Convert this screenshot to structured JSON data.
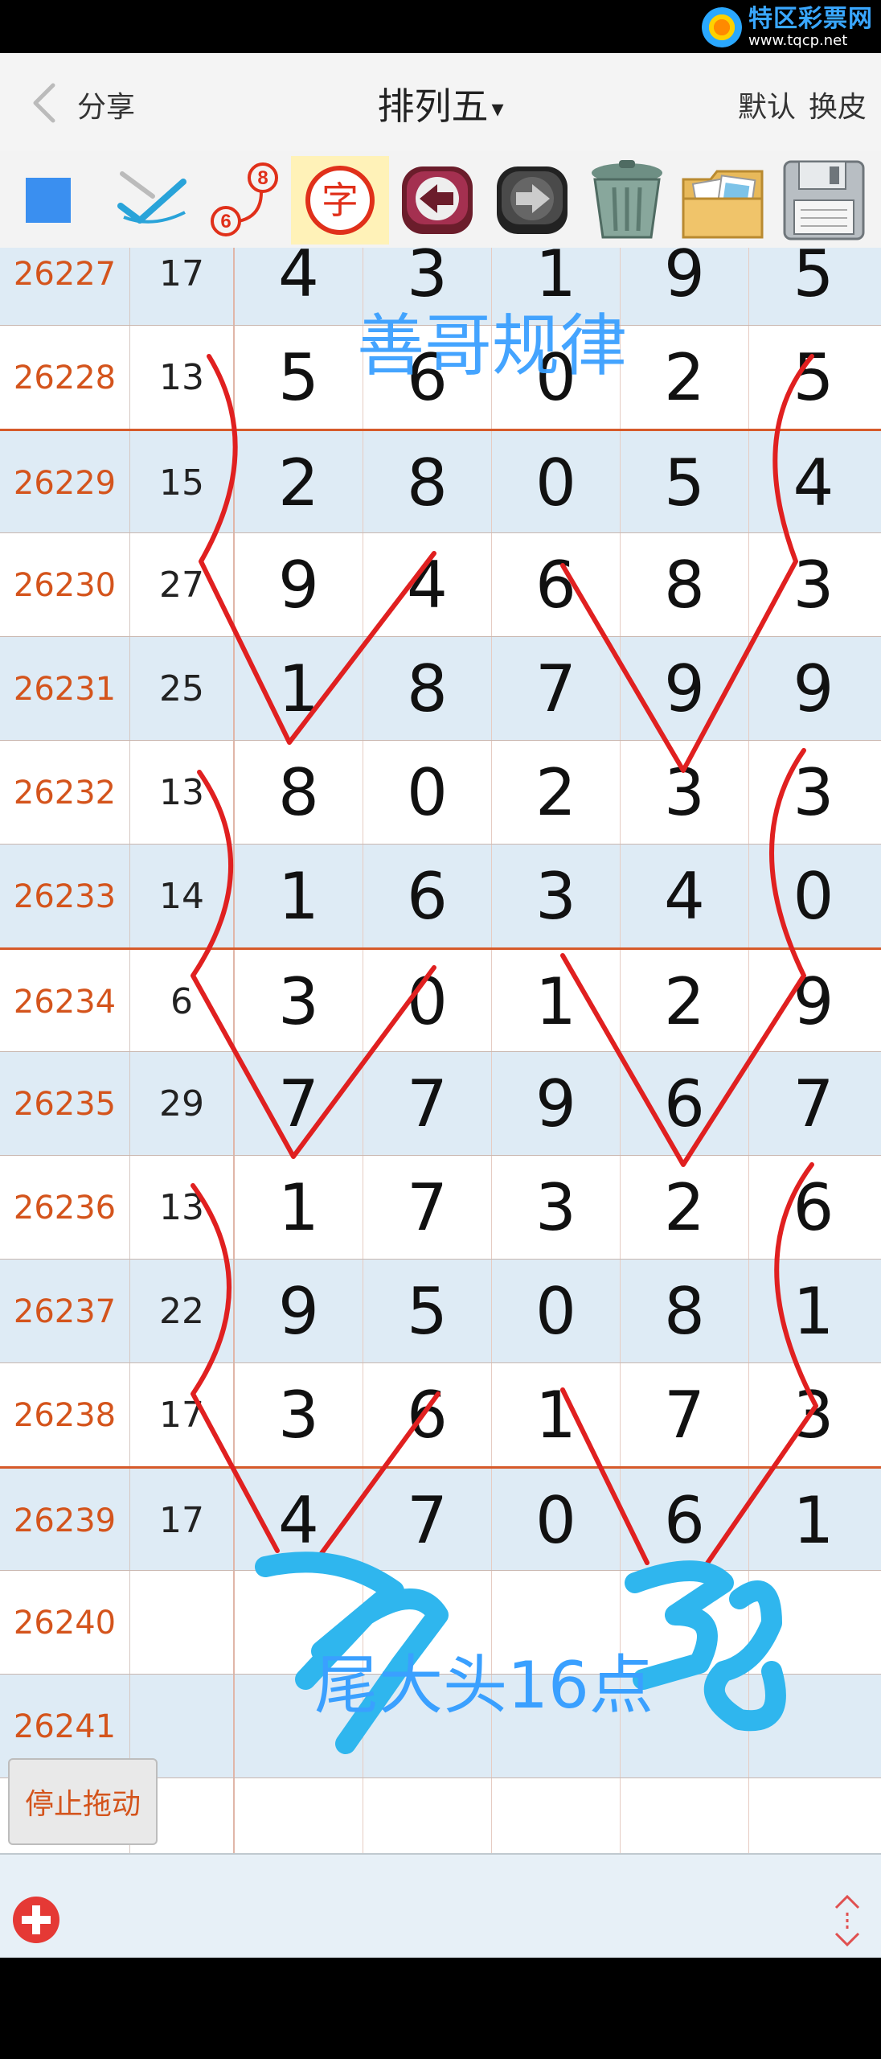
{
  "watermark": {
    "title": "特区彩票网",
    "url": "www.tqcp.net"
  },
  "header": {
    "share_label": "分享",
    "title": "排列五",
    "title_caret": "▾",
    "action_default": "默认",
    "action_skin": "换皮"
  },
  "toolbar": {
    "tools": [
      "square-tool",
      "pen-check-tool",
      "line-6-8-tool",
      "character-tool",
      "undo-tool",
      "redo-tool",
      "trash-tool",
      "gallery-tool",
      "save-tool"
    ],
    "char_glyph": "字",
    "num_six": "6",
    "num_eight": "8"
  },
  "table": {
    "rows": [
      {
        "issue": "26227",
        "sum": "17",
        "digits": [
          "4",
          "3",
          "1",
          "9",
          "5"
        ]
      },
      {
        "issue": "26228",
        "sum": "13",
        "digits": [
          "5",
          "6",
          "0",
          "2",
          "5"
        ]
      },
      {
        "issue": "26229",
        "sum": "15",
        "digits": [
          "2",
          "8",
          "0",
          "5",
          "4"
        ]
      },
      {
        "issue": "26230",
        "sum": "27",
        "digits": [
          "9",
          "4",
          "6",
          "8",
          "3"
        ]
      },
      {
        "issue": "26231",
        "sum": "25",
        "digits": [
          "1",
          "8",
          "7",
          "9",
          "9"
        ]
      },
      {
        "issue": "26232",
        "sum": "13",
        "digits": [
          "8",
          "0",
          "2",
          "3",
          "3"
        ]
      },
      {
        "issue": "26233",
        "sum": "14",
        "digits": [
          "1",
          "6",
          "3",
          "4",
          "0"
        ]
      },
      {
        "issue": "26234",
        "sum": "6",
        "digits": [
          "3",
          "0",
          "1",
          "2",
          "9"
        ]
      },
      {
        "issue": "26235",
        "sum": "29",
        "digits": [
          "7",
          "7",
          "9",
          "6",
          "7"
        ]
      },
      {
        "issue": "26236",
        "sum": "13",
        "digits": [
          "1",
          "7",
          "3",
          "2",
          "6"
        ]
      },
      {
        "issue": "26237",
        "sum": "22",
        "digits": [
          "9",
          "5",
          "0",
          "8",
          "1"
        ]
      },
      {
        "issue": "26238",
        "sum": "17",
        "digits": [
          "3",
          "6",
          "1",
          "7",
          "3"
        ]
      },
      {
        "issue": "26239",
        "sum": "17",
        "digits": [
          "4",
          "7",
          "0",
          "6",
          "1"
        ]
      },
      {
        "issue": "26240",
        "sum": "",
        "digits": [
          "",
          "",
          "",
          "",
          ""
        ]
      },
      {
        "issue": "26241",
        "sum": "",
        "digits": [
          "",
          "",
          "",
          "",
          ""
        ]
      },
      {
        "issue": "",
        "sum": "",
        "digits": [
          "",
          "",
          "",
          "",
          ""
        ]
      }
    ]
  },
  "annotations": {
    "top_text": "善哥规律",
    "bottom_text": "尾大头16点",
    "hand_left": "27",
    "hand_right": "38"
  },
  "buttons": {
    "stop_drag": "停止拖动"
  },
  "colors": {
    "issue_text": "#d4541c",
    "row_alt": "#deebf5",
    "group_line": "#d65a2a",
    "annotation_red": "#e02020",
    "annotation_blue": "#3aa0ff"
  }
}
